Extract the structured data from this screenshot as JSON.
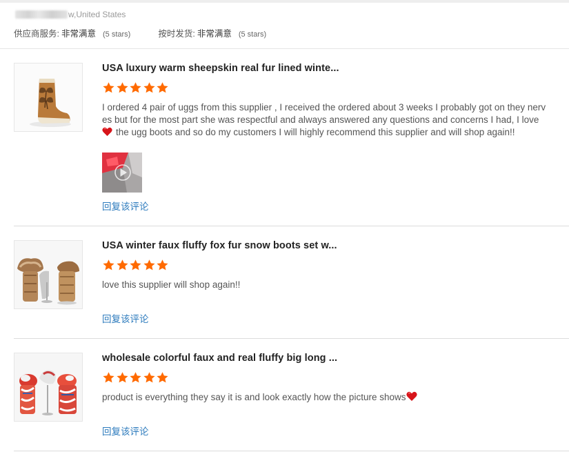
{
  "reviewer": {
    "country": "w,United States"
  },
  "ratings": [
    {
      "label": "供应商服务:",
      "value": "非常满意",
      "stars": "(5 stars)"
    },
    {
      "label": "按时发货:",
      "value": "非常满意",
      "stars": "(5 stars)"
    }
  ],
  "reviews": [
    {
      "title": "USA luxury warm sheepskin real fur lined winte...",
      "rating": 5,
      "text_lines": [
        "I ordered 4 pair of uggs from this supplier , I received the ordered about 3 weeks I probably got on they nerv",
        "es but for the most part she was respectful and always answered any questions and concerns I had, I love",
        "the ugg boots and so do my customers I will highly recommend this supplier and will shop again!!"
      ],
      "reply_label": "回复该评论",
      "icons": [
        "heart-icon",
        "play-icon"
      ]
    },
    {
      "title": "USA winter faux fluffy fox fur snow boots set w...",
      "rating": 5,
      "text": "love this supplier will shop again!!",
      "reply_label": "回复该评论"
    },
    {
      "title": "wholesale colorful faux and real fluffy big long ...",
      "rating": 5,
      "text": "product is everything they say it is and look exactly how the picture shows",
      "reply_label": "回复该评论",
      "icons": [
        "heart-icon"
      ]
    }
  ],
  "colors": {
    "star": "#ff6a00",
    "link": "#2d7bbd",
    "heart": "#d7141a"
  }
}
